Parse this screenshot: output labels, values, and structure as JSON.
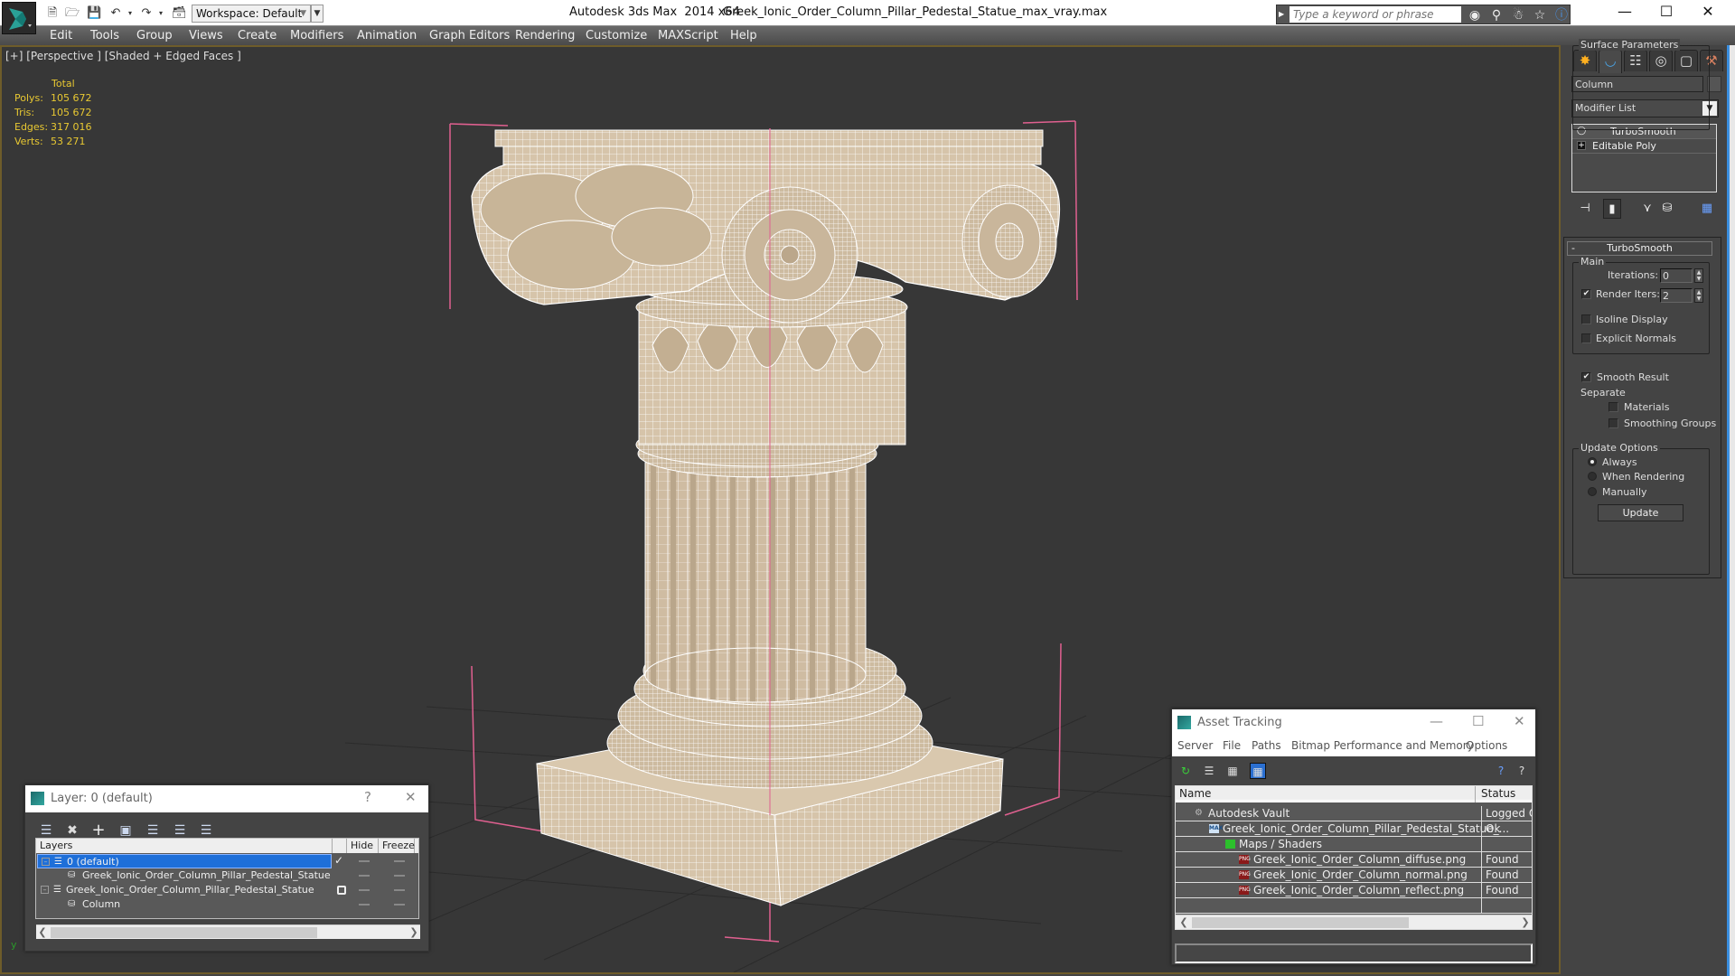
{
  "titlebar": {
    "app_title": "Autodesk 3ds Max  2014 x64",
    "file_name": "Greek_Ionic_Order_Column_Pillar_Pedestal_Statue_max_vray.max",
    "workspace": "Workspace: Default",
    "search_placeholder": "Type a keyword or phrase",
    "quick_access": [
      "new-file",
      "open-file",
      "save-file",
      "undo",
      "redo",
      "project-folder"
    ],
    "search_tools": [
      "binoculars",
      "key",
      "satellite",
      "star",
      "help"
    ]
  },
  "menu": [
    "Edit",
    "Tools",
    "Group",
    "Views",
    "Create",
    "Modifiers",
    "Animation",
    "Graph Editors",
    "Rendering",
    "Customize",
    "MAXScript",
    "Help"
  ],
  "viewport": {
    "label": "[+] [Perspective ] [Shaded + Edged Faces ]",
    "stats": {
      "header": "Total",
      "rows": [
        {
          "label": "Polys:",
          "value": "105 672"
        },
        {
          "label": "Tris:",
          "value": "105 672"
        },
        {
          "label": "Edges:",
          "value": "317 016"
        },
        {
          "label": "Verts:",
          "value": "53 271"
        }
      ]
    },
    "axis_label": "y"
  },
  "command_panel": {
    "tabs": [
      "create",
      "modify",
      "hierarchy",
      "motion",
      "display",
      "utilities"
    ],
    "active_tab": "modify",
    "object_name": "Column",
    "modifier_list": "Modifier List",
    "stack": [
      {
        "label": "TurboSmooth",
        "icon": "lightbulb"
      },
      {
        "label": "Editable Poly",
        "icon": "plus-box"
      }
    ],
    "rollout": {
      "title": "TurboSmooth",
      "collapse": "-",
      "main": {
        "title": "Main",
        "iterations_label": "Iterations:",
        "iterations": "0",
        "render_iters_label": "Render Iters:",
        "render_iters": "2",
        "render_iters_checked": true,
        "isoline_label": "Isoline Display",
        "isoline_checked": false,
        "explicit_normals_label": "Explicit Normals",
        "explicit_normals_checked": false
      },
      "surface": {
        "title": "Surface Parameters",
        "smooth_result_label": "Smooth Result",
        "smooth_result_checked": true,
        "separate_label": "Separate",
        "materials_label": "Materials",
        "materials_checked": false,
        "smoothing_groups_label": "Smoothing Groups",
        "smoothing_groups_checked": false
      },
      "update": {
        "title": "Update Options",
        "options": [
          "Always",
          "When Rendering",
          "Manually"
        ],
        "selected": "Always",
        "button": "Update"
      }
    }
  },
  "layer_dialog": {
    "title": "Layer: 0 (default)",
    "help": "?",
    "close": "✕",
    "columns": [
      "Layers",
      "",
      "Hide",
      "Freeze"
    ],
    "rows": [
      {
        "name": "0 (default)",
        "level": 0,
        "type": "layer",
        "selected": true,
        "current": "check"
      },
      {
        "name": "Greek_Ionic_Order_Column_Pillar_Pedestal_Statue",
        "level": 1,
        "type": "object",
        "selected": false,
        "current": ""
      },
      {
        "name": "Greek_Ionic_Order_Column_Pillar_Pedestal_Statue",
        "level": 0,
        "type": "layer",
        "selected": false,
        "current": "box"
      },
      {
        "name": "Column",
        "level": 1,
        "type": "object",
        "selected": false,
        "current": ""
      }
    ]
  },
  "asset_dialog": {
    "title": "Asset Tracking",
    "menu": [
      "Server",
      "File",
      "Paths",
      "Bitmap Performance and Memory",
      "Options"
    ],
    "columns": [
      "Name",
      "Status"
    ],
    "rows": [
      {
        "name": "Autodesk Vault",
        "status": "Logged Ou",
        "level": 0,
        "icon": "vault"
      },
      {
        "name": "Greek_Ionic_Order_Column_Pillar_Pedestal_Statue_...",
        "status": "Ok",
        "level": 1,
        "icon": "max-file"
      },
      {
        "name": "Maps / Shaders",
        "status": "",
        "level": 2,
        "icon": "maps"
      },
      {
        "name": "Greek_Ionic_Order_Column_diffuse.png",
        "status": "Found",
        "level": 3,
        "icon": "png"
      },
      {
        "name": "Greek_Ionic_Order_Column_normal.png",
        "status": "Found",
        "level": 3,
        "icon": "png"
      },
      {
        "name": "Greek_Ionic_Order_Column_reflect.png",
        "status": "Found",
        "level": 3,
        "icon": "png"
      }
    ]
  },
  "colors": {
    "viewport_border": "#6e5c2a",
    "stats_text": "#e8c832",
    "selection": "#1e6fd9",
    "bbox_pink": "#e06090",
    "stone": "#d8c6ad"
  }
}
